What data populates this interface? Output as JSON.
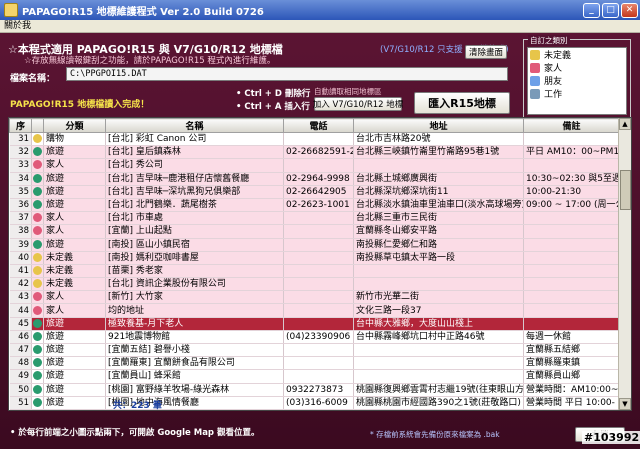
{
  "window": {
    "title": "PAPAGO!R15 地標維護程式 Ver 2.0 Build 0726"
  },
  "menu": {
    "items": [
      "關於我"
    ]
  },
  "header": {
    "line1": "☆本程式適用 PAPAGO!R15 與 V7/G10/R12 地標檔",
    "line1_note": "(V7/G10/R12 只支援 txt 檔格式)",
    "line2": "☆存放無線讀報鍵刮之功能，請於PAPAGO!R15 程式內進行維護。"
  },
  "buttons": {
    "clear": "清除畫面",
    "add_v7": "加入 V7/G10/R12 地標",
    "import": "匯入R15地標",
    "save": "存檔"
  },
  "file": {
    "label": "檔案名稱：",
    "value": "C:\\PPGPOI15.DAT"
  },
  "status": "PAPAGO!R15 地標檔讀入完成！",
  "hints": {
    "ctrl_d": "• Ctrl + D 刪除行",
    "ctrl_a": "• Ctrl + A 插入行",
    "auto": "自動讀取相同地標區"
  },
  "categories": {
    "legend": "自訂之類別",
    "items": [
      {
        "label": "未定義",
        "color": "#e7c54a"
      },
      {
        "label": "家人",
        "color": "#e05a7a"
      },
      {
        "label": "朋友",
        "color": "#6da0e8"
      },
      {
        "label": "工作",
        "color": "#7a9ab8"
      }
    ]
  },
  "table": {
    "headers": [
      "序",
      "",
      "分類",
      "名稱",
      "電話",
      "地址",
      "備註"
    ],
    "rows": [
      {
        "n": "31",
        "cat": "購物",
        "name": "[台北] 彩虹 Canon 公司",
        "phone": "",
        "addr": "台北市吉林路20號",
        "note": "",
        "icon": "#e7c54a",
        "style": ""
      },
      {
        "n": "32",
        "cat": "旅遊",
        "name": "[台北] 皇后鎮森林",
        "phone": "02-26682591-2",
        "addr": "台北縣三峽鎮竹崙里竹崙路95巷1號",
        "note": "平日 AM10：00~PM1",
        "icon": "#2a9b6e",
        "style": "pink"
      },
      {
        "n": "33",
        "cat": "家人",
        "name": "[台北] 秀公司",
        "phone": "",
        "addr": "",
        "note": "",
        "icon": "#e05a7a",
        "style": "pink"
      },
      {
        "n": "34",
        "cat": "旅遊",
        "name": "[台北] 吉早味─鹿港租仔店懷舊餐廳",
        "phone": "02-2964-9998",
        "addr": "台北縣土城鄉廣興街",
        "note": "10:30~02:30 與5至週",
        "icon": "#2a9b6e",
        "style": "pink"
      },
      {
        "n": "35",
        "cat": "旅遊",
        "name": "[台北] 吉早味─深坑黑狗兄俱樂部",
        "phone": "02-26642905",
        "addr": "台北縣深坑鄉深坑街11",
        "note": "10:00-21:30",
        "icon": "#2a9b6e",
        "style": "pink"
      },
      {
        "n": "36",
        "cat": "旅遊",
        "name": "[台北] 北門鶴樂．蔬尾樹茶",
        "phone": "02-2623-1001",
        "addr": "台北縣淡水鎮油車里油車口(淡水高球場旁)",
        "note": "09:00 ~ 17:00 (周一公",
        "icon": "#2a9b6e",
        "style": "pink"
      },
      {
        "n": "37",
        "cat": "家人",
        "name": "[台北] 市車處",
        "phone": "",
        "addr": "台北縣三重市三民街",
        "note": "",
        "icon": "#e05a7a",
        "style": "pink"
      },
      {
        "n": "38",
        "cat": "家人",
        "name": "[宜蘭] 上山起點",
        "phone": "",
        "addr": "宜蘭縣冬山鄉安平路",
        "note": "",
        "icon": "#e05a7a",
        "style": "pink"
      },
      {
        "n": "39",
        "cat": "旅遊",
        "name": "[南投] 區山小鎮民宿",
        "phone": "",
        "addr": "南投縣仁愛鄉仁和路",
        "note": "",
        "icon": "#2a9b6e",
        "style": "pink"
      },
      {
        "n": "40",
        "cat": "未定義",
        "name": "[南投] 媽利亞咖啡書屋",
        "phone": "",
        "addr": "南投縣草屯鎮太平路一段",
        "note": "",
        "icon": "#e7c54a",
        "style": "pink"
      },
      {
        "n": "41",
        "cat": "未定義",
        "name": "[苗栗] 秀老家",
        "phone": "",
        "addr": "",
        "note": "",
        "icon": "#e7c54a",
        "style": "pink"
      },
      {
        "n": "42",
        "cat": "未定義",
        "name": "[台北] 資訊企業股份有限公司",
        "phone": "",
        "addr": "",
        "note": "",
        "icon": "#e7c54a",
        "style": "pink"
      },
      {
        "n": "43",
        "cat": "家人",
        "name": "[新竹] 大竹家",
        "phone": "",
        "addr": "新竹市光華二街",
        "note": "",
        "icon": "#e05a7a",
        "style": "pink"
      },
      {
        "n": "44",
        "cat": "家人",
        "name": "均的地址",
        "phone": "",
        "addr": "文化三路一段37",
        "note": "",
        "icon": "#e05a7a",
        "style": "pink"
      },
      {
        "n": "45",
        "cat": "旅遊",
        "name": "極致養基-月下老人",
        "phone": "",
        "addr": "台中縣大雅鄉，大度山山棧上",
        "note": "",
        "icon": "#2a9b6e",
        "style": "selected"
      },
      {
        "n": "46",
        "cat": "旅遊",
        "name": "921地震博物館",
        "phone": "(04)23390906",
        "addr": "台中縣霧峰鄉坑口村中正路46號",
        "note": "每週一休館",
        "icon": "#2a9b6e",
        "style": ""
      },
      {
        "n": "47",
        "cat": "旅遊",
        "name": "[宜蘭五結] 碧譽小棧",
        "phone": "",
        "addr": "",
        "note": "宜蘭縣五結鄉",
        "icon": "#2a9b6e",
        "style": ""
      },
      {
        "n": "48",
        "cat": "旅遊",
        "name": "[宜蘭羅東] 宜蘭餅食品有限公司",
        "phone": "",
        "addr": "",
        "note": "宜蘭縣羅東鎮",
        "icon": "#2a9b6e",
        "style": ""
      },
      {
        "n": "49",
        "cat": "旅遊",
        "name": "[宜蘭員山] 蜂采館",
        "phone": "",
        "addr": "",
        "note": "宜蘭縣員山鄉",
        "icon": "#2a9b6e",
        "style": ""
      },
      {
        "n": "50",
        "cat": "旅遊",
        "name": "[桃園] 富野綠羊牧場-綠光森林",
        "phone": "0932273873",
        "addr": "桃園縣復興鄉雲霄村志繼19號(往東眼山方向)",
        "note": "營業時間：AM10:00~",
        "icon": "#2a9b6e",
        "style": ""
      },
      {
        "n": "51",
        "cat": "旅遊",
        "name": "[桃園] 地中海風情餐廳",
        "phone": "(03)316-6009",
        "addr": "桃園縣桃園市經國路390之1號(莊敬路口)",
        "note": "營業時間 平日 10:00-",
        "icon": "#2a9b6e",
        "style": ""
      }
    ],
    "total": "共：223 筆"
  },
  "footer": {
    "left": "• 於每行前端之小圖示點兩下，可開啟 Google Map 觀看位置。",
    "right": "* 存檔前系統會先備份原來檔案為 .bak"
  },
  "watermark": "#103992"
}
